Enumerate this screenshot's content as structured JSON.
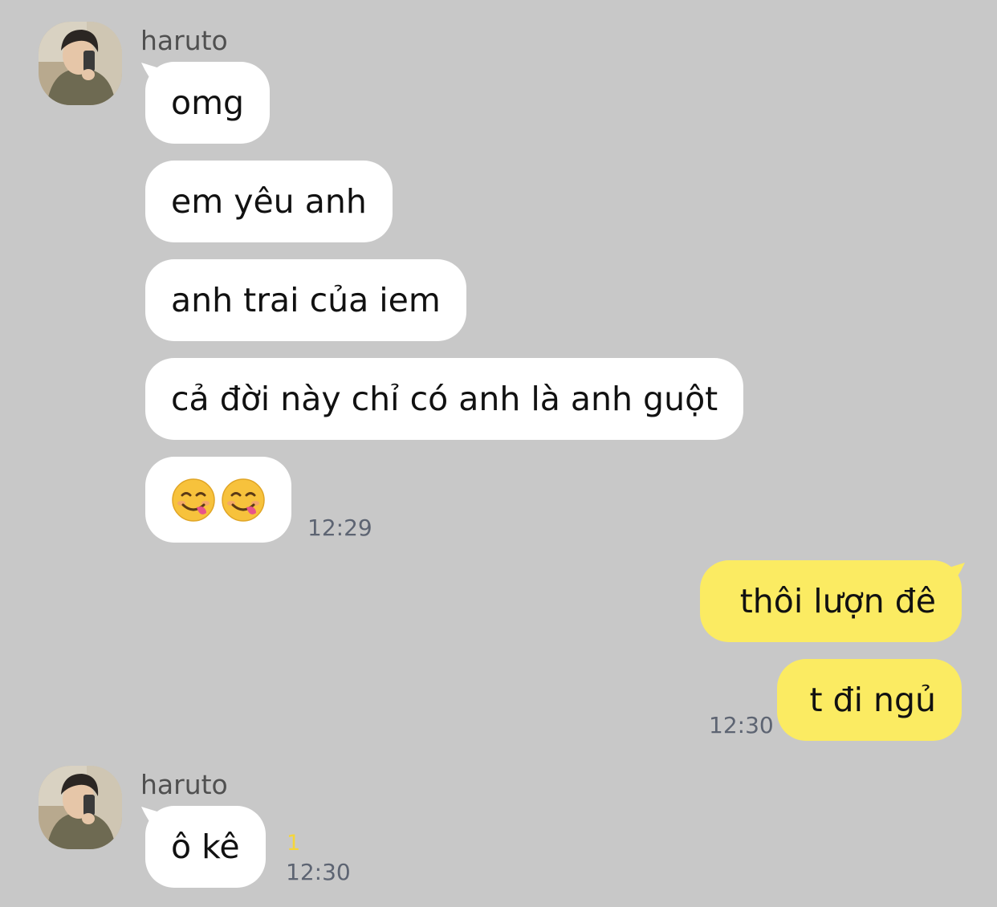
{
  "chat": {
    "messages_block_1": {
      "sender": "haruto",
      "bubbles": [
        "omg",
        "em yêu anh",
        "anh trai của iem",
        "cả đời này chỉ có anh là anh guột"
      ],
      "emoji_names": [
        "savoring-food-face-emoji",
        "savoring-food-face-emoji"
      ],
      "time": "12:29"
    },
    "messages_block_2": {
      "bubbles": [
        "thôi lượn đê",
        "t đi ngủ"
      ],
      "time": "12:30"
    },
    "messages_block_3": {
      "sender": "haruto",
      "bubbles": [
        "ô kê"
      ],
      "unread_count": "1",
      "time": "12:30"
    }
  },
  "colors": {
    "background": "#c8c8c8",
    "incoming_bubble": "#ffffff",
    "outgoing_bubble": "#fbeb62",
    "unread": "#f5d63a"
  }
}
